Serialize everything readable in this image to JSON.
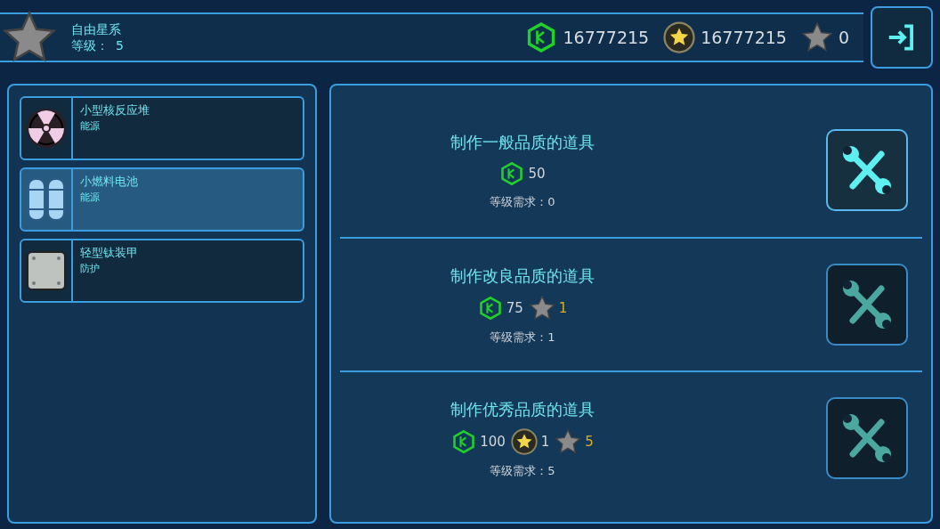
{
  "player": {
    "name": "自由星系",
    "level_label": "等级：",
    "level": "5"
  },
  "currencies": [
    {
      "kind": "crystal",
      "amount": "16777215"
    },
    {
      "kind": "coin",
      "amount": "16777215"
    },
    {
      "kind": "star",
      "amount": "0"
    }
  ],
  "items": [
    {
      "name": "小型核反应堆",
      "category": "能源",
      "kind": "reactor",
      "selected": false
    },
    {
      "name": "小燃料电池",
      "category": "能源",
      "kind": "fuel-cell",
      "selected": true
    },
    {
      "name": "轻型钛装甲",
      "category": "防护",
      "kind": "armor",
      "selected": false
    }
  ],
  "recipes": [
    {
      "title": "制作一般品质的道具",
      "costs": [
        {
          "kind": "crystal",
          "amount": "50"
        }
      ],
      "requirement": "等级需求：0",
      "enabled": true
    },
    {
      "title": "制作改良品质的道具",
      "costs": [
        {
          "kind": "crystal",
          "amount": "75"
        },
        {
          "kind": "star",
          "amount": "1"
        }
      ],
      "requirement": "等级需求：1",
      "enabled": false
    },
    {
      "title": "制作优秀品质的道具",
      "costs": [
        {
          "kind": "crystal",
          "amount": "100"
        },
        {
          "kind": "coin",
          "amount": "1"
        },
        {
          "kind": "star",
          "amount": "5"
        }
      ],
      "requirement": "等级需求：5",
      "enabled": false
    }
  ]
}
